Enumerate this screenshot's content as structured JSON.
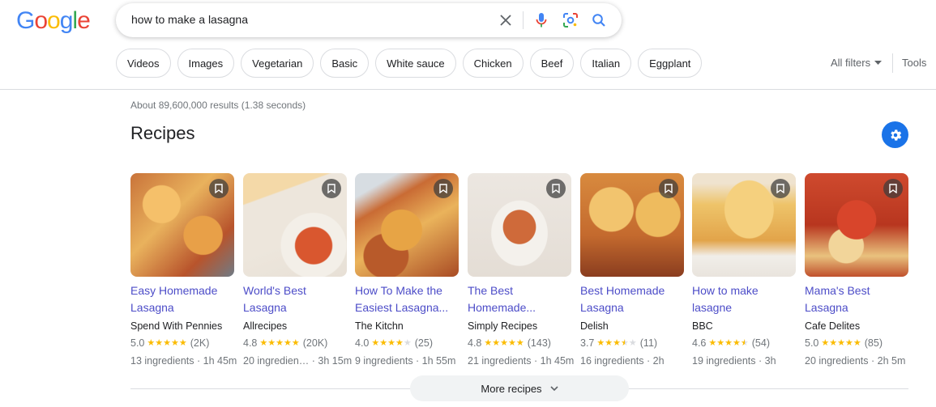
{
  "logo": {
    "letters": [
      "G",
      "o",
      "o",
      "g",
      "l",
      "e"
    ],
    "colors": [
      "#4285f4",
      "#ea4335",
      "#fbbc05",
      "#4285f4",
      "#34a853",
      "#ea4335"
    ]
  },
  "search": {
    "query": "how to make a lasagna",
    "icons": [
      "close-icon",
      "microphone-icon",
      "lens-icon",
      "search-icon"
    ]
  },
  "chips": [
    "Videos",
    "Images",
    "Vegetarian",
    "Basic",
    "White sauce",
    "Chicken",
    "Beef",
    "Italian",
    "Eggplant"
  ],
  "filters": {
    "all_filters": "All filters",
    "tools": "Tools"
  },
  "stats": "About 89,600,000 results (1.38 seconds)",
  "section_title": "Recipes",
  "colors": {
    "accent": "#1a73e8",
    "link": "#4d4dc8",
    "star": "#fbbc04"
  },
  "recipes": [
    {
      "title": "Easy Homemade Lasagna",
      "source": "Spend With Pennies",
      "rating": "5.0",
      "stars": 5,
      "count": "(2K)",
      "meta": "13 ingredients · 1h 45m"
    },
    {
      "title": "World's Best Lasagna",
      "source": "Allrecipes",
      "rating": "4.8",
      "stars": 5,
      "count": "(20K)",
      "meta": "20 ingredien… · 3h 15m"
    },
    {
      "title": "How To Make the Easiest Lasagna...",
      "source": "The Kitchn",
      "rating": "4.0",
      "stars": 4,
      "count": "(25)",
      "meta": "9 ingredients · 1h 55m"
    },
    {
      "title": "The Best Homemade...",
      "source": "Simply Recipes",
      "rating": "4.8",
      "stars": 5,
      "count": "(143)",
      "meta": "21 ingredients · 1h 45m"
    },
    {
      "title": "Best Homemade Lasagna",
      "source": "Delish",
      "rating": "3.7",
      "stars": 3.5,
      "count": "(11)",
      "meta": "16 ingredients · 2h"
    },
    {
      "title": "How to make lasagne",
      "source": "BBC",
      "rating": "4.6",
      "stars": 4.5,
      "count": "(54)",
      "meta": "19 ingredients · 3h"
    },
    {
      "title": "Mama's Best Lasagna",
      "source": "Cafe Delites",
      "rating": "5.0",
      "stars": 5,
      "count": "(85)",
      "meta": "20 ingredients · 2h 5m"
    }
  ],
  "more_recipes": "More recipes"
}
